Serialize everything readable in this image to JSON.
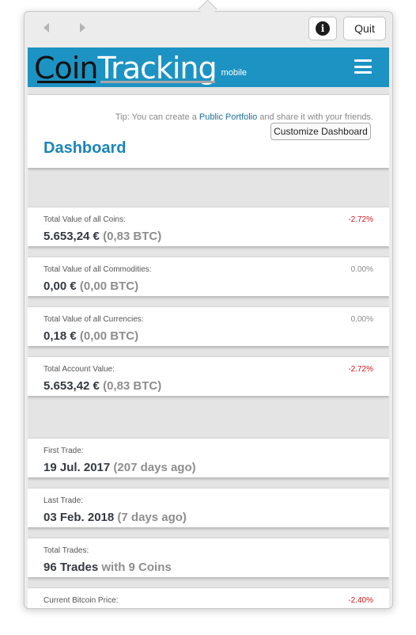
{
  "toolbar": {
    "quit_label": "Quit",
    "info_glyph": "i"
  },
  "header": {
    "logo_part1": "Coin",
    "logo_part2": "Tracking",
    "logo_suffix": "mobile",
    "brand_color": "#1c93c3"
  },
  "dashboard": {
    "tip_prefix": "Tip: You can create a ",
    "tip_link": "Public Portfolio",
    "tip_suffix": " and share it with your friends.",
    "customize_label": "Customize Dashboard",
    "title": "Dashboard"
  },
  "stats": {
    "coins": {
      "label": "Total Value of all Coins:",
      "pct": "-2.72%",
      "value": "5.653,24 €",
      "sub": " (0,83 BTC)"
    },
    "commodities": {
      "label": "Total Value of all Commodities:",
      "pct": "0.00%",
      "value": "0,00 €",
      "sub": " (0,00 BTC)"
    },
    "currencies": {
      "label": "Total Value of all Currencies:",
      "pct": "0.00%",
      "value": "0,18 €",
      "sub": " (0,00 BTC)"
    },
    "account": {
      "label": "Total Account Value:",
      "pct": "-2.72%",
      "value": "5.653,42 €",
      "sub": " (0,83 BTC)"
    },
    "first_trade": {
      "label": "First Trade:",
      "value": "19 Jul. 2017",
      "sub": " (207 days ago)"
    },
    "last_trade": {
      "label": "Last Trade:",
      "value": "03 Feb. 2018",
      "sub": " (7 days ago)"
    },
    "total_trades": {
      "label": "Total Trades:",
      "value": "96 Trades",
      "sub": " with 9 Coins"
    },
    "btc_price": {
      "label": "Current Bitcoin Price:",
      "pct": "-2.40%"
    }
  },
  "colors": {
    "negative": "#d3151c",
    "neutral": "#888888",
    "title": "#1b85b8"
  }
}
